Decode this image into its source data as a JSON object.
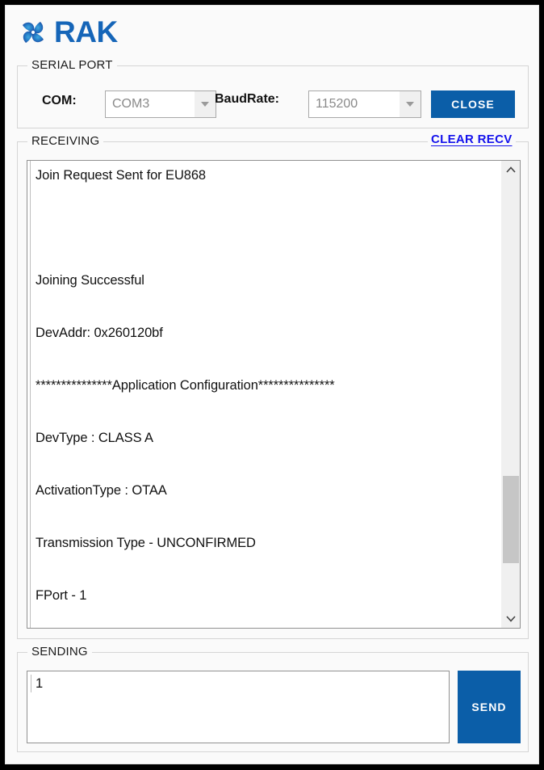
{
  "app": {
    "logo_text": "RAK",
    "logo_icon": "rak-pinwheel-logo"
  },
  "serial_port": {
    "group_title": "SERIAL PORT",
    "com_label": "COM:",
    "com_value": "COM3",
    "baud_label": "BaudRate:",
    "baud_value": "115200",
    "close_label": "CLOSE"
  },
  "receiving": {
    "group_title": "RECEIVING",
    "clear_link_label": "CLEAR RECV",
    "lines": [
      "Join Request Sent for EU868",
      "",
      "Joining Successful",
      "DevAddr: 0x260120bf",
      "***************Application Configuration***************",
      "DevType : CLASS A",
      "ActivationType : OTAA",
      "Transmission Type - UNCONFIRMED",
      "FPort - 1"
    ],
    "scrollbar": {
      "up_icon": "chevron-up-icon",
      "down_icon": "chevron-down-icon"
    }
  },
  "sending": {
    "group_title": "SENDING",
    "value": "1",
    "placeholder": "",
    "send_label": "SEND"
  },
  "colors": {
    "brand_blue": "#1565b8",
    "button_blue": "#0b5ea8",
    "link_blue": "#1412ec",
    "window_bg": "#fafafa",
    "frame_black": "#000000"
  }
}
